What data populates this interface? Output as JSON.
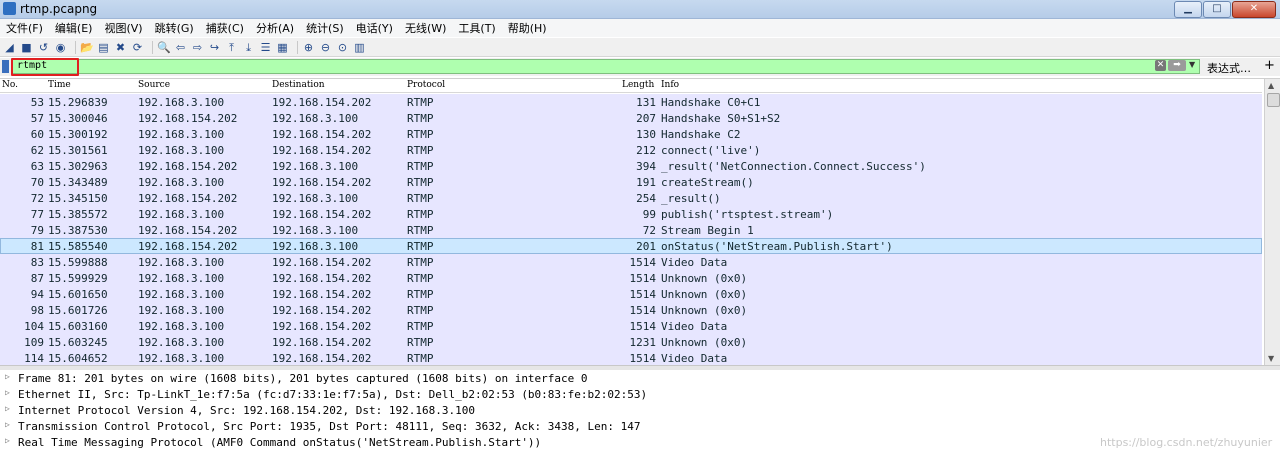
{
  "window": {
    "title": "rtmp.pcapng"
  },
  "menu": [
    "文件(F)",
    "编辑(E)",
    "视图(V)",
    "跳转(G)",
    "捕获(C)",
    "分析(A)",
    "统计(S)",
    "电话(Y)",
    "无线(W)",
    "工具(T)",
    "帮助(H)"
  ],
  "toolbar_icons": [
    "shark-fin-icon",
    "stop-icon",
    "restart-icon",
    "options-icon",
    "open-icon",
    "save-icon",
    "close-file-icon",
    "reload-icon",
    "find-icon",
    "back-icon",
    "forward-icon",
    "goto-icon",
    "first-icon",
    "last-icon",
    "autoscroll-icon",
    "colorize-icon",
    "zoom-in-icon",
    "zoom-out-icon",
    "zoom-reset-icon",
    "resize-columns-icon"
  ],
  "filter": {
    "value": "rtmpt",
    "expression_label": "表达式…",
    "plus_label": "+"
  },
  "columns": {
    "no": "No.",
    "time": "Time",
    "source": "Source",
    "destination": "Destination",
    "protocol": "Protocol",
    "length": "Length",
    "info": "Info"
  },
  "packets": [
    {
      "no": "53",
      "time": "15.296839",
      "src": "192.168.3.100",
      "dst": "192.168.154.202",
      "proto": "RTMP",
      "len": "131",
      "info": "Handshake C0+C1"
    },
    {
      "no": "57",
      "time": "15.300046",
      "src": "192.168.154.202",
      "dst": "192.168.3.100",
      "proto": "RTMP",
      "len": "207",
      "info": "Handshake S0+S1+S2"
    },
    {
      "no": "60",
      "time": "15.300192",
      "src": "192.168.3.100",
      "dst": "192.168.154.202",
      "proto": "RTMP",
      "len": "130",
      "info": "Handshake C2"
    },
    {
      "no": "62",
      "time": "15.301561",
      "src": "192.168.3.100",
      "dst": "192.168.154.202",
      "proto": "RTMP",
      "len": "212",
      "info": "connect('live')"
    },
    {
      "no": "63",
      "time": "15.302963",
      "src": "192.168.154.202",
      "dst": "192.168.3.100",
      "proto": "RTMP",
      "len": "394",
      "info": "_result('NetConnection.Connect.Success')"
    },
    {
      "no": "70",
      "time": "15.343489",
      "src": "192.168.3.100",
      "dst": "192.168.154.202",
      "proto": "RTMP",
      "len": "191",
      "info": "createStream()"
    },
    {
      "no": "72",
      "time": "15.345150",
      "src": "192.168.154.202",
      "dst": "192.168.3.100",
      "proto": "RTMP",
      "len": "254",
      "info": "_result()"
    },
    {
      "no": "77",
      "time": "15.385572",
      "src": "192.168.3.100",
      "dst": "192.168.154.202",
      "proto": "RTMP",
      "len": "99",
      "info": "publish('rtsptest.stream')"
    },
    {
      "no": "79",
      "time": "15.387530",
      "src": "192.168.154.202",
      "dst": "192.168.3.100",
      "proto": "RTMP",
      "len": "72",
      "info": "Stream Begin 1"
    },
    {
      "no": "81",
      "time": "15.585540",
      "src": "192.168.154.202",
      "dst": "192.168.3.100",
      "proto": "RTMP",
      "len": "201",
      "info": "onStatus('NetStream.Publish.Start')",
      "selected": true
    },
    {
      "no": "83",
      "time": "15.599888",
      "src": "192.168.3.100",
      "dst": "192.168.154.202",
      "proto": "RTMP",
      "len": "1514",
      "info": "Video Data"
    },
    {
      "no": "87",
      "time": "15.599929",
      "src": "192.168.3.100",
      "dst": "192.168.154.202",
      "proto": "RTMP",
      "len": "1514",
      "info": "Unknown (0x0)"
    },
    {
      "no": "94",
      "time": "15.601650",
      "src": "192.168.3.100",
      "dst": "192.168.154.202",
      "proto": "RTMP",
      "len": "1514",
      "info": "Unknown (0x0)"
    },
    {
      "no": "98",
      "time": "15.601726",
      "src": "192.168.3.100",
      "dst": "192.168.154.202",
      "proto": "RTMP",
      "len": "1514",
      "info": "Unknown (0x0)"
    },
    {
      "no": "104",
      "time": "15.603160",
      "src": "192.168.3.100",
      "dst": "192.168.154.202",
      "proto": "RTMP",
      "len": "1514",
      "info": "Video Data"
    },
    {
      "no": "109",
      "time": "15.603245",
      "src": "192.168.3.100",
      "dst": "192.168.154.202",
      "proto": "RTMP",
      "len": "1231",
      "info": "Unknown (0x0)"
    },
    {
      "no": "114",
      "time": "15.604652",
      "src": "192.168.3.100",
      "dst": "192.168.154.202",
      "proto": "RTMP",
      "len": "1514",
      "info": "Video Data"
    }
  ],
  "details": [
    "Frame 81: 201 bytes on wire (1608 bits), 201 bytes captured (1608 bits) on interface 0",
    "Ethernet II, Src: Tp-LinkT_1e:f7:5a (fc:d7:33:1e:f7:5a), Dst: Dell_b2:02:53 (b0:83:fe:b2:02:53)",
    "Internet Protocol Version 4, Src: 192.168.154.202, Dst: 192.168.3.100",
    "Transmission Control Protocol, Src Port: 1935, Dst Port: 48111, Seq: 3632, Ack: 3438, Len: 147",
    "Real Time Messaging Protocol (AMF0 Command onStatus('NetStream.Publish.Start'))"
  ],
  "watermark": "https://blog.csdn.net/zhuyunier",
  "colors": {
    "row_bg": "#e7e6ff",
    "row_selected": "#cce8ff",
    "filter_ok": "#afffaf",
    "highlight": "#e02020"
  }
}
